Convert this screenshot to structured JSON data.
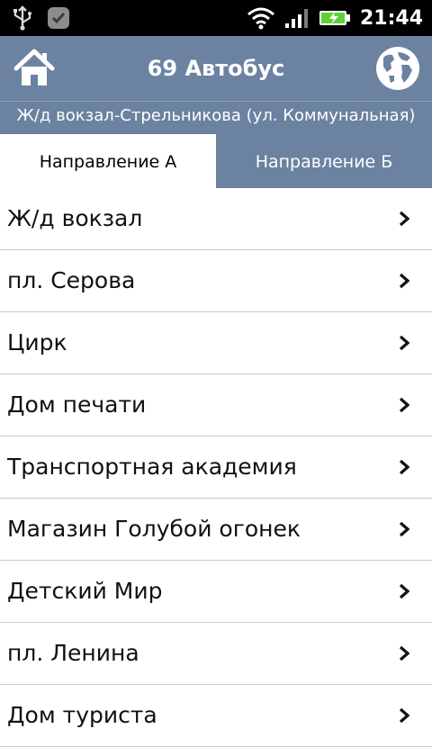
{
  "status_bar": {
    "time": "21:44",
    "icons": [
      "usb-icon",
      "notification-app-icon",
      "wifi-icon",
      "signal-icon",
      "battery-charging-icon"
    ]
  },
  "header": {
    "title": "69 Автобус",
    "home_icon": "home-icon",
    "globe_icon": "globe-icon"
  },
  "route": {
    "name": "Ж/д вокзал-Стрельникова (ул. Коммунальная)"
  },
  "tabs": [
    {
      "label": "Направление А",
      "active": true
    },
    {
      "label": "Направление Б",
      "active": false
    }
  ],
  "stops": [
    {
      "label": "Ж/д вокзал"
    },
    {
      "label": "пл. Серова"
    },
    {
      "label": "Цирк"
    },
    {
      "label": "Дом печати"
    },
    {
      "label": "Транспортная академия"
    },
    {
      "label": "Магазин Голубой огонек"
    },
    {
      "label": "Детский Мир"
    },
    {
      "label": "пл. Ленина"
    },
    {
      "label": "Дом туриста"
    }
  ],
  "colors": {
    "header_bg": "#6b82a1",
    "status_bg": "#000000",
    "battery": "#5fd13a"
  }
}
